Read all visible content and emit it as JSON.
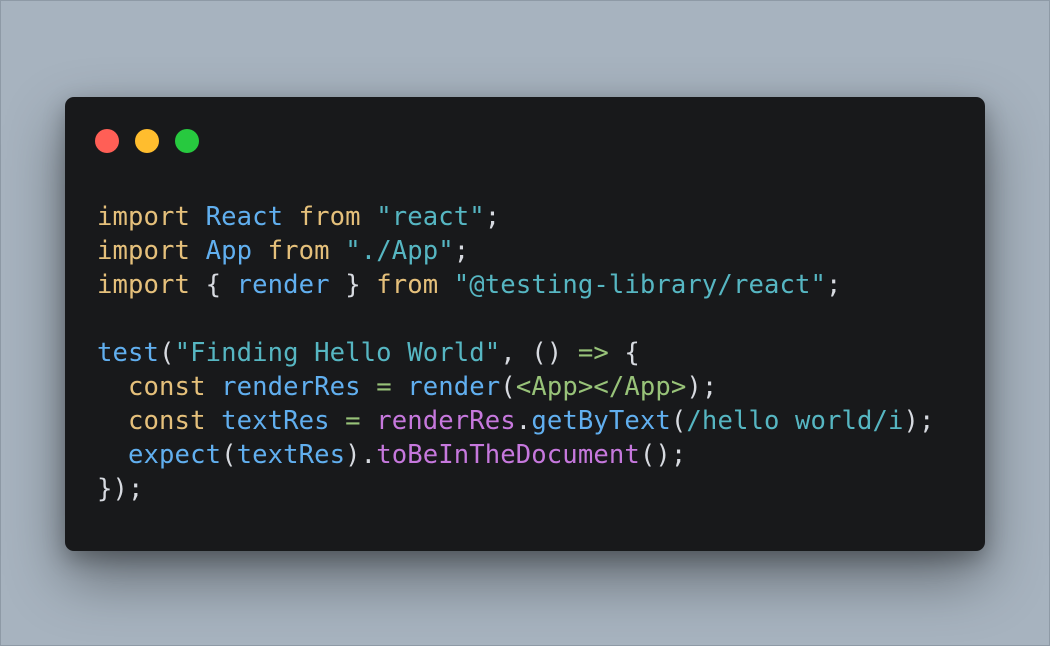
{
  "window": {
    "controls": [
      {
        "name": "close",
        "color": "#ff5f56"
      },
      {
        "name": "minimize",
        "color": "#ffbd2e"
      },
      {
        "name": "maximize",
        "color": "#27c93f"
      }
    ]
  },
  "code": {
    "l1": {
      "kw1": "import",
      "id": "React",
      "kw2": "from",
      "str": "\"react\"",
      "end": ";"
    },
    "l2": {
      "kw1": "import",
      "id": "App",
      "kw2": "from",
      "str": "\"./App\"",
      "end": ";"
    },
    "l3": {
      "kw1": "import",
      "open": "{",
      "id": "render",
      "close": "}",
      "kw2": "from",
      "str": "\"@testing-library/react\"",
      "end": ";"
    },
    "l5": {
      "fn": "test",
      "p1": "(",
      "str": "\"Finding Hello World\"",
      "sep": ", ",
      "args": "()",
      "arrow": "=>",
      "brace": "{"
    },
    "l6": {
      "kw": "const",
      "var": "renderRes",
      "eq": "=",
      "fn": "render",
      "p1": "(",
      "jsx_open": "<App>",
      "jsx_close": "</App>",
      "p2": ");"
    },
    "l7": {
      "kw": "const",
      "var": "textRes",
      "eq": "=",
      "obj": "renderRes",
      "dot": ".",
      "method": "getByText",
      "p1": "(",
      "regex": "/hello world/i",
      "p2": ");"
    },
    "l8": {
      "fn": "expect",
      "p1": "(",
      "arg": "textRes",
      "p2": ").",
      "method": "toBeInTheDocument",
      "p3": "();"
    },
    "l9": {
      "text": "});"
    }
  }
}
